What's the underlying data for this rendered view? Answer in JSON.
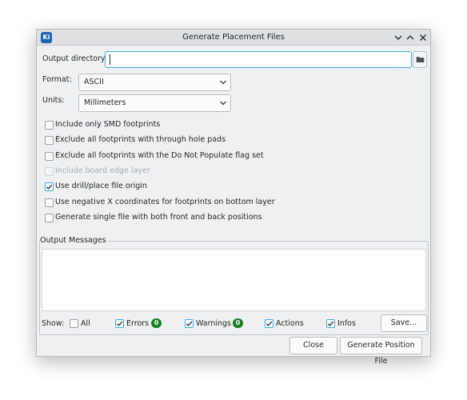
{
  "window": {
    "title": "Generate Placement Files",
    "app_icon_text": "Ki"
  },
  "output_dir": {
    "label": "Output directory:",
    "value": ""
  },
  "format": {
    "label": "Format:",
    "selected": "ASCII"
  },
  "units": {
    "label": "Units:",
    "selected": "Millimeters"
  },
  "options": [
    {
      "label": "Include only SMD footprints",
      "checked": false,
      "disabled": false
    },
    {
      "label": "Exclude all footprints with through hole pads",
      "checked": false,
      "disabled": false
    },
    {
      "label": "Exclude all footprints with the Do Not Populate flag set",
      "checked": false,
      "disabled": false
    },
    {
      "label": "Include board edge layer",
      "checked": false,
      "disabled": true
    },
    {
      "label": "Use drill/place file origin",
      "checked": true,
      "disabled": false
    },
    {
      "label": "Use negative X coordinates for footprints on bottom layer",
      "checked": false,
      "disabled": false
    },
    {
      "label": "Generate single file with both front and back positions",
      "checked": false,
      "disabled": false
    }
  ],
  "messages": {
    "title": "Output Messages",
    "show_label": "Show:",
    "filters": {
      "all": {
        "label": "All",
        "checked": false
      },
      "errors": {
        "label": "Errors",
        "checked": true,
        "count": "0"
      },
      "warnings": {
        "label": "Warnings",
        "checked": true,
        "count": "0"
      },
      "actions": {
        "label": "Actions",
        "checked": true
      },
      "infos": {
        "label": "Infos",
        "checked": true
      }
    },
    "save_label": "Save..."
  },
  "buttons": {
    "close": "Close",
    "generate": "Generate Position File"
  },
  "colors": {
    "accent": "#3daee9",
    "badge": "#197f22"
  }
}
